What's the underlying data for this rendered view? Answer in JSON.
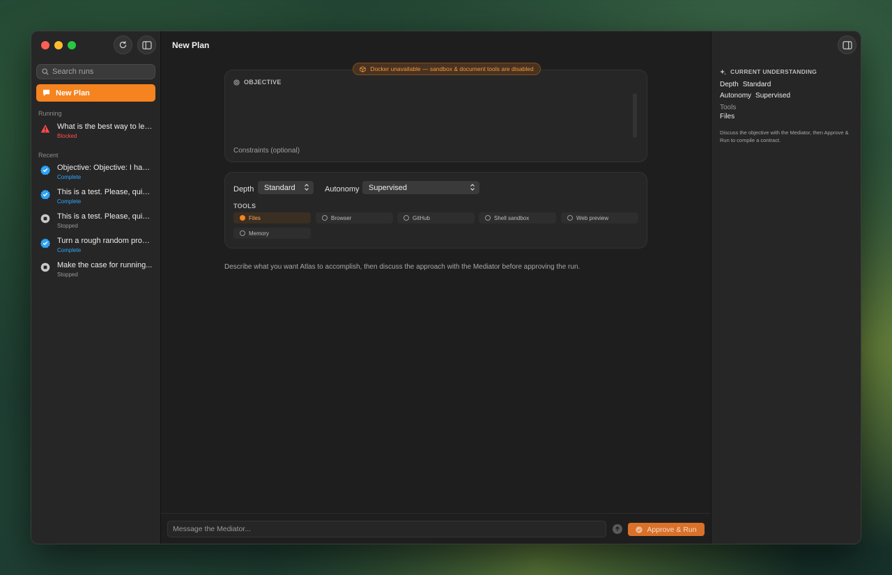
{
  "window": {
    "title": "New Plan"
  },
  "sidebar": {
    "search_placeholder": "Search runs",
    "new_plan_label": "New Plan",
    "running_label": "Running",
    "recent_label": "Recent",
    "running": [
      {
        "title": "What is the best way to lea...",
        "status": "Blocked",
        "icon": "warning-icon"
      }
    ],
    "recent": [
      {
        "title": "Objective: Objective: I have...",
        "status": "Complete",
        "icon": "check-badge-icon"
      },
      {
        "title": "This is a test. Please, quick...",
        "status": "Complete",
        "icon": "check-badge-icon"
      },
      {
        "title": "This is a test. Please, quick...",
        "status": "Stopped",
        "icon": "stop-icon"
      },
      {
        "title": "Turn a rough random prod...",
        "status": "Complete",
        "icon": "check-badge-icon"
      },
      {
        "title": "Make the case for running...",
        "status": "Stopped",
        "icon": "stop-icon"
      }
    ]
  },
  "banner": {
    "warning": "Docker unavailable — sandbox & document tools are disabled"
  },
  "objective": {
    "label": "OBJECTIVE",
    "constraints_placeholder": "Constraints (optional)"
  },
  "settings": {
    "depth_label": "Depth",
    "depth_value": "Standard",
    "autonomy_label": "Autonomy",
    "autonomy_value": "Supervised",
    "tools_label": "TOOLS",
    "tools": [
      {
        "label": "Files",
        "selected": true
      },
      {
        "label": "Browser",
        "selected": false
      },
      {
        "label": "GitHub",
        "selected": false
      },
      {
        "label": "Shell sandbox",
        "selected": false
      },
      {
        "label": "Web preview",
        "selected": false
      },
      {
        "label": "Memory",
        "selected": false
      }
    ]
  },
  "hint": "Describe what you want Atlas to accomplish, then discuss the approach with the Mediator before approving the run.",
  "composer": {
    "placeholder": "Message the Mediator...",
    "approve_label": "Approve & Run"
  },
  "understanding": {
    "heading": "CURRENT UNDERSTANDING",
    "depth_key": "Depth",
    "depth_value": "Standard",
    "autonomy_key": "Autonomy",
    "autonomy_value": "Supervised",
    "tools_key": "Tools",
    "tools_value": "Files",
    "note": "Discuss the objective with the Mediator, then Approve & Run to compile a contract."
  },
  "colors": {
    "accent": "#f5831f",
    "complete": "#2fa9ff",
    "blocked": "#ff4f4f",
    "warning": "#f09a3c"
  }
}
